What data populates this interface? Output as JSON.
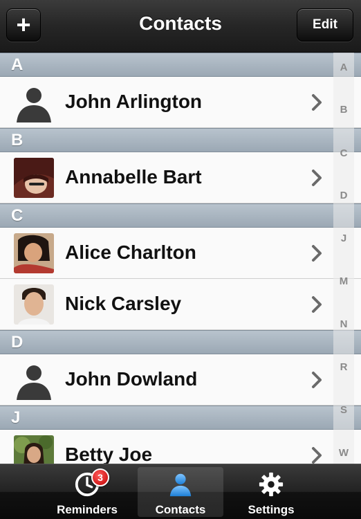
{
  "header": {
    "title": "Contacts",
    "add_label": "+",
    "edit_label": "Edit"
  },
  "sections": [
    {
      "letter": "A",
      "contacts": [
        {
          "name": "John Arlington",
          "avatar": "placeholder-silhouette-icon"
        }
      ]
    },
    {
      "letter": "B",
      "contacts": [
        {
          "name": "Annabelle Bart",
          "avatar": "photo"
        }
      ]
    },
    {
      "letter": "C",
      "contacts": [
        {
          "name": "Alice Charlton",
          "avatar": "photo"
        },
        {
          "name": "Nick Carsley",
          "avatar": "photo"
        }
      ]
    },
    {
      "letter": "D",
      "contacts": [
        {
          "name": "John Dowland",
          "avatar": "placeholder-silhouette-icon"
        }
      ]
    },
    {
      "letter": "J",
      "contacts": [
        {
          "name": "Betty Joe",
          "avatar": "photo"
        }
      ]
    }
  ],
  "index": [
    "A",
    "B",
    "C",
    "D",
    "J",
    "M",
    "N",
    "R",
    "S",
    "W"
  ],
  "tabs": [
    {
      "label": "Reminders",
      "icon": "clock-icon",
      "badge": "3",
      "active": false
    },
    {
      "label": "Contacts",
      "icon": "person-icon",
      "active": true
    },
    {
      "label": "Settings",
      "icon": "gear-icon",
      "active": false
    }
  ],
  "colors": {
    "section_header": "#a9b5c1",
    "active_tab_icon": "#3a9ee8",
    "badge": "#d40000"
  }
}
